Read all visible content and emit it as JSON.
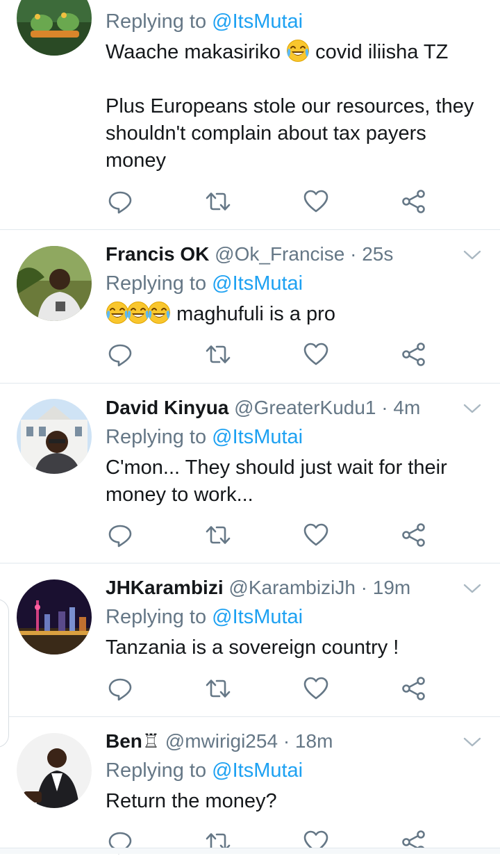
{
  "colors": {
    "accent": "#1da1f2",
    "secondary_text": "#657786",
    "divider": "#e1e8ed"
  },
  "tweets": [
    {
      "replying_prefix": "Replying to",
      "replying_to": "@ItsMutai",
      "text": "Waache makasiriko",
      "text_after_emoji": "covid iliisha TZ",
      "text_line2": "Plus Europeans stole our resources, they shouldn't complain about tax payers money",
      "emoji": "face-with-tears-of-joy"
    },
    {
      "name": "Francis OK",
      "handle": "@Ok_Francise",
      "sep": "·",
      "time": "25s",
      "replying_prefix": "Replying to",
      "replying_to": "@ItsMutai",
      "text": "maghufuli is a pro",
      "emoji": "face-with-tears-of-joy"
    },
    {
      "name": "David Kinyua",
      "handle": "@GreaterKudu1",
      "sep": "·",
      "time": "4m",
      "replying_prefix": "Replying to",
      "replying_to": "@ItsMutai",
      "text": "C'mon... They should just wait for their money to work..."
    },
    {
      "name": "JHKarambizi",
      "handle": "@KarambiziJh",
      "sep": "·",
      "time": "19m",
      "replying_prefix": "Replying to",
      "replying_to": "@ItsMutai",
      "text": "Tanzania is a sovereign country !"
    },
    {
      "name": "Ben♖",
      "handle": "@mwirigi254",
      "sep": "·",
      "time": "18m",
      "replying_prefix": "Replying to",
      "replying_to": "@ItsMutai",
      "text": "Return the money?"
    }
  ],
  "actions": {
    "reply": "reply-icon",
    "retweet": "retweet-icon",
    "like": "heart-icon",
    "share": "share-icon"
  }
}
